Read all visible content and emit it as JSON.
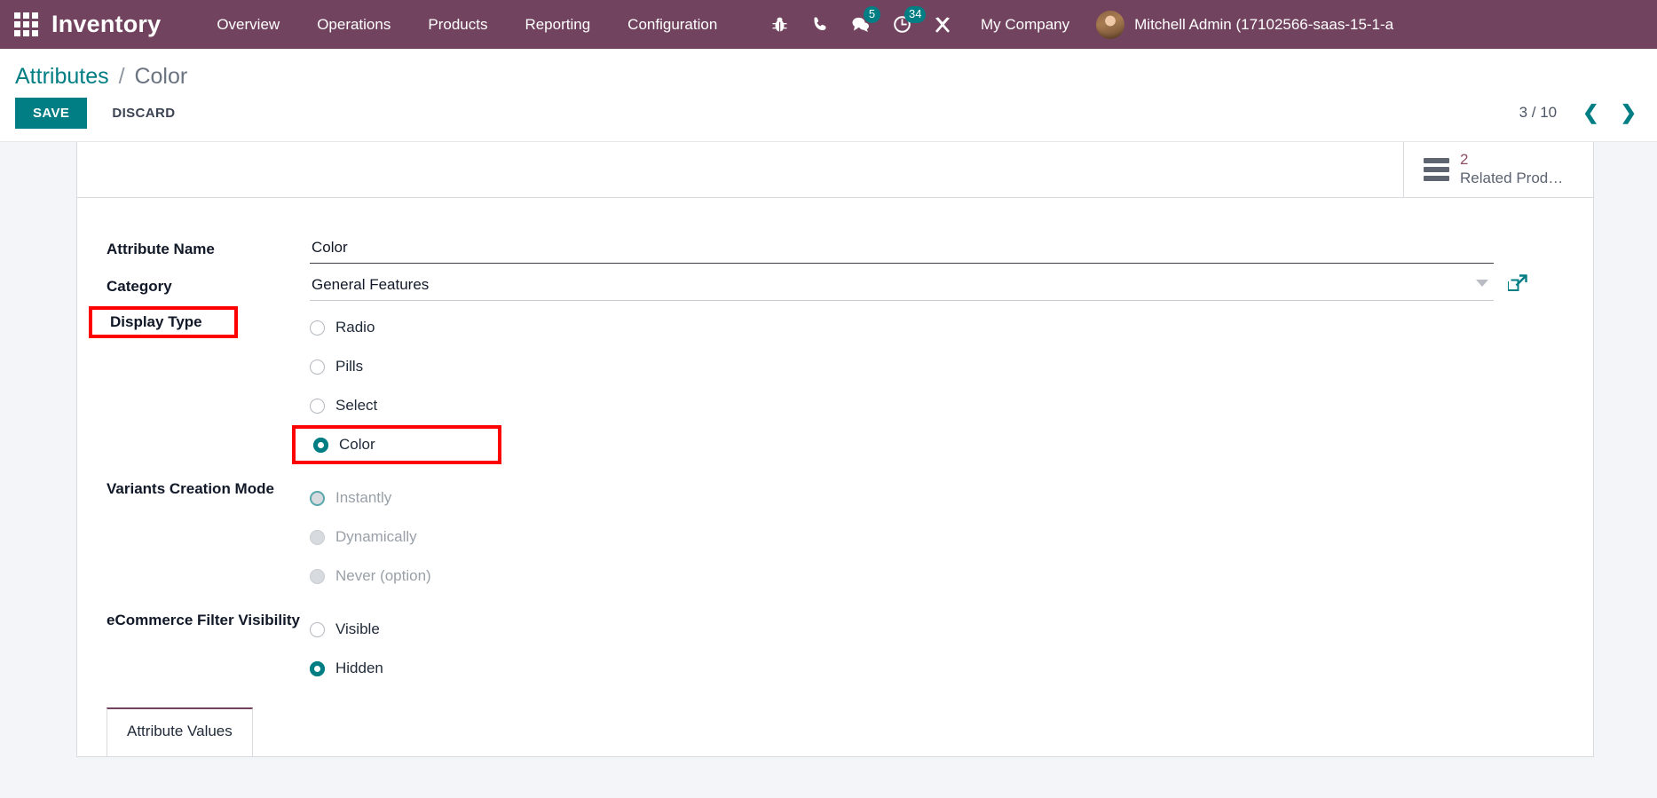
{
  "navbar": {
    "apps_icon": "apps-grid-icon",
    "brand": "Inventory",
    "menus": [
      {
        "label": "Overview"
      },
      {
        "label": "Operations"
      },
      {
        "label": "Products"
      },
      {
        "label": "Reporting"
      },
      {
        "label": "Configuration"
      }
    ],
    "icons": [
      {
        "name": "bug-icon",
        "badge": null
      },
      {
        "name": "phone-icon",
        "badge": null
      },
      {
        "name": "messages-icon",
        "badge": "5"
      },
      {
        "name": "activities-clock-icon",
        "badge": "34"
      },
      {
        "name": "tools-icon",
        "badge": null
      }
    ],
    "company": "My Company",
    "user": "Mitchell Admin (17102566-saas-15-1-a",
    "bg_color": "#71435f",
    "badge_color": "#017e84"
  },
  "control_panel": {
    "breadcrumb_root": "Attributes",
    "breadcrumb_sep": "/",
    "breadcrumb_current": "Color",
    "save_label": "SAVE",
    "discard_label": "DISCARD",
    "pager_text": "3 / 10",
    "prev_icon": "chevron-left-icon",
    "next_icon": "chevron-right-icon",
    "accent_color": "#017e84"
  },
  "smart_button": {
    "icon": "list-bars-icon",
    "value": "2",
    "label": "Related Prod…"
  },
  "form": {
    "attribute_name": {
      "label": "Attribute Name",
      "value": "Color"
    },
    "category": {
      "label": "Category",
      "value": "General Features",
      "caret_icon": "chevron-down-icon",
      "external_icon": "external-link-icon"
    },
    "display_type": {
      "label": "Display Type",
      "highlighted": true,
      "options": [
        {
          "label": "Radio",
          "checked": false,
          "highlighted": false
        },
        {
          "label": "Pills",
          "checked": false,
          "highlighted": false
        },
        {
          "label": "Select",
          "checked": false,
          "highlighted": false
        },
        {
          "label": "Color",
          "checked": true,
          "highlighted": true
        }
      ]
    },
    "variants_creation_mode": {
      "label": "Variants Creation Mode",
      "disabled": true,
      "options": [
        {
          "label": "Instantly",
          "checked": true
        },
        {
          "label": "Dynamically",
          "checked": false
        },
        {
          "label": "Never (option)",
          "checked": false
        }
      ]
    },
    "ecommerce_filter_visibility": {
      "label": "eCommerce Filter Visibility",
      "options": [
        {
          "label": "Visible",
          "checked": false
        },
        {
          "label": "Hidden",
          "checked": true
        }
      ]
    }
  },
  "notebook": {
    "tabs": [
      {
        "label": "Attribute Values",
        "active": true
      }
    ]
  },
  "annotation_color": "#ff0000"
}
